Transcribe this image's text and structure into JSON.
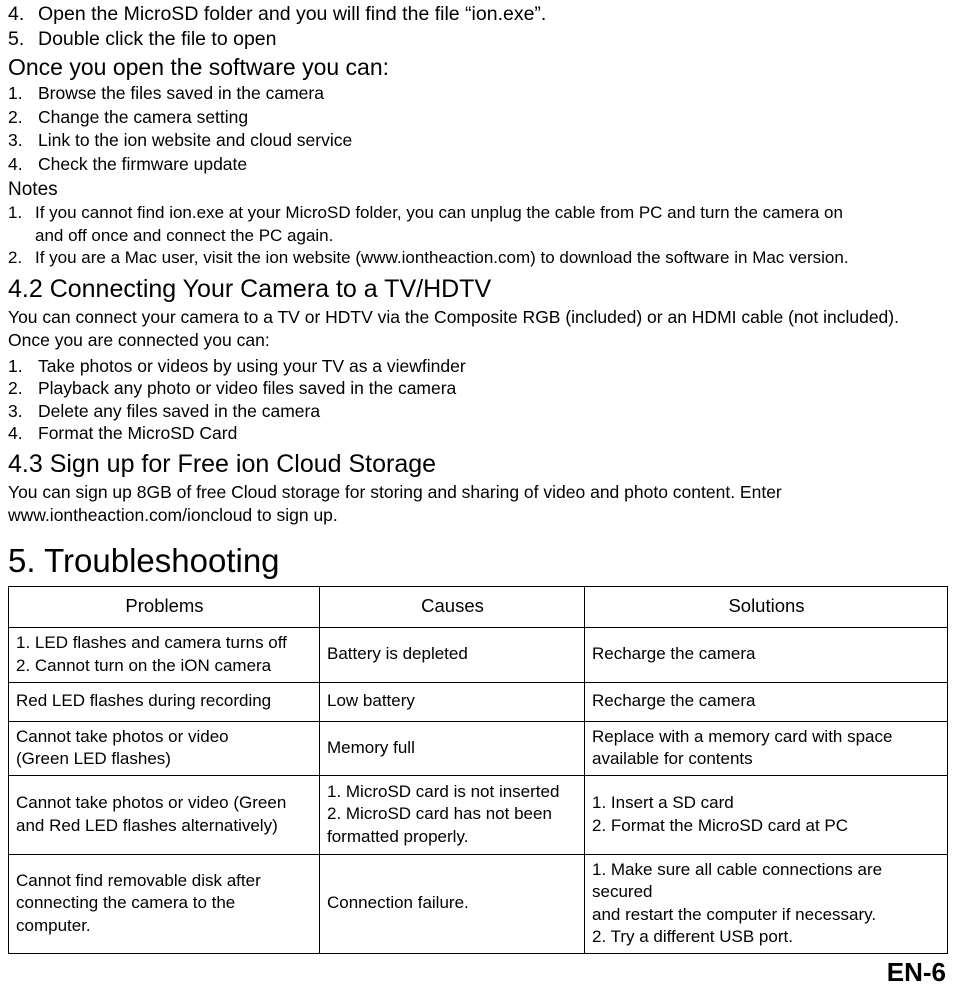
{
  "top_list": [
    {
      "num": "4.",
      "text": "Open the MicroSD folder and you will find the file “ion.exe”."
    },
    {
      "num": "5.",
      "text": "Double click the file to open"
    }
  ],
  "once_heading": "Once you open the software you can:",
  "capability_list": [
    {
      "num": "1.",
      "text": "Browse the files saved in the camera"
    },
    {
      "num": "2.",
      "text": "Change the camera setting"
    },
    {
      "num": "3.",
      "text": "Link to the ion website and cloud service"
    },
    {
      "num": "4.",
      "text": "Check the firmware update"
    }
  ],
  "notes_heading": "Notes",
  "notes_list": [
    {
      "num": "1.",
      "line1": "If you cannot find ion.exe at your MicroSD folder, you can unplug the cable from PC and turn the camera on",
      "line2": "and off once and connect the PC again."
    },
    {
      "num": "2.",
      "line1": "If you are a Mac user, visit the ion website (www.iontheaction.com) to download the software in Mac version.",
      "line2": ""
    }
  ],
  "section_42": {
    "heading": "4.2 Connecting Your Camera to a TV/HDTV",
    "paragraph": "You can connect your camera to a TV or HDTV via the Composite RGB (included) or an HDMI cable (not included). Once you are connected you can:",
    "list": [
      {
        "num": "1.",
        "text": "Take photos or videos by using your TV as a viewfinder"
      },
      {
        "num": "2.",
        "text": "Playback any photo or video files saved in the camera"
      },
      {
        "num": "3.",
        "text": "Delete any files saved in the camera"
      },
      {
        "num": "4.",
        "text": "Format the MicroSD Card"
      }
    ]
  },
  "section_43": {
    "heading": "4.3 Sign up for Free ion Cloud Storage",
    "paragraph": "You can sign up 8GB of free Cloud storage for storing and sharing of video and photo content. Enter www.iontheaction.com/ioncloud to sign up."
  },
  "section_5": {
    "heading": "5. Troubleshooting",
    "table": {
      "headers": [
        "Problems",
        "Causes",
        "Solutions"
      ],
      "rows": [
        {
          "problem": [
            "1. LED flashes and camera turns off",
            "2. Cannot turn on the iON camera"
          ],
          "cause": [
            "Battery is depleted"
          ],
          "solution": [
            "Recharge the camera"
          ]
        },
        {
          "problem": [
            "Red LED flashes during recording"
          ],
          "cause": [
            "Low battery"
          ],
          "solution": [
            "Recharge the camera"
          ]
        },
        {
          "problem": [
            "Cannot take photos or video",
            "(Green LED flashes)"
          ],
          "cause": [
            "Memory full"
          ],
          "solution": [
            "Replace with a memory card with space",
            "available for contents"
          ]
        },
        {
          "problem": [
            "Cannot take photos or video (Green",
            "and Red LED flashes alternatively)"
          ],
          "cause": [
            "1. MicroSD card is not inserted",
            "2. MicroSD card has not been",
            "formatted properly."
          ],
          "solution": [
            "1. Insert a SD card",
            "2. Format the MicroSD card at PC"
          ]
        },
        {
          "problem": [
            "Cannot find removable disk after",
            "connecting the camera to the",
            "computer."
          ],
          "cause": [
            "Connection failure."
          ],
          "solution": [
            "1. Make sure all cable connections are secured",
            "and restart the computer if necessary.",
            "2. Try a different USB port."
          ]
        }
      ]
    }
  },
  "footer": {
    "page_label": "EN-6"
  }
}
